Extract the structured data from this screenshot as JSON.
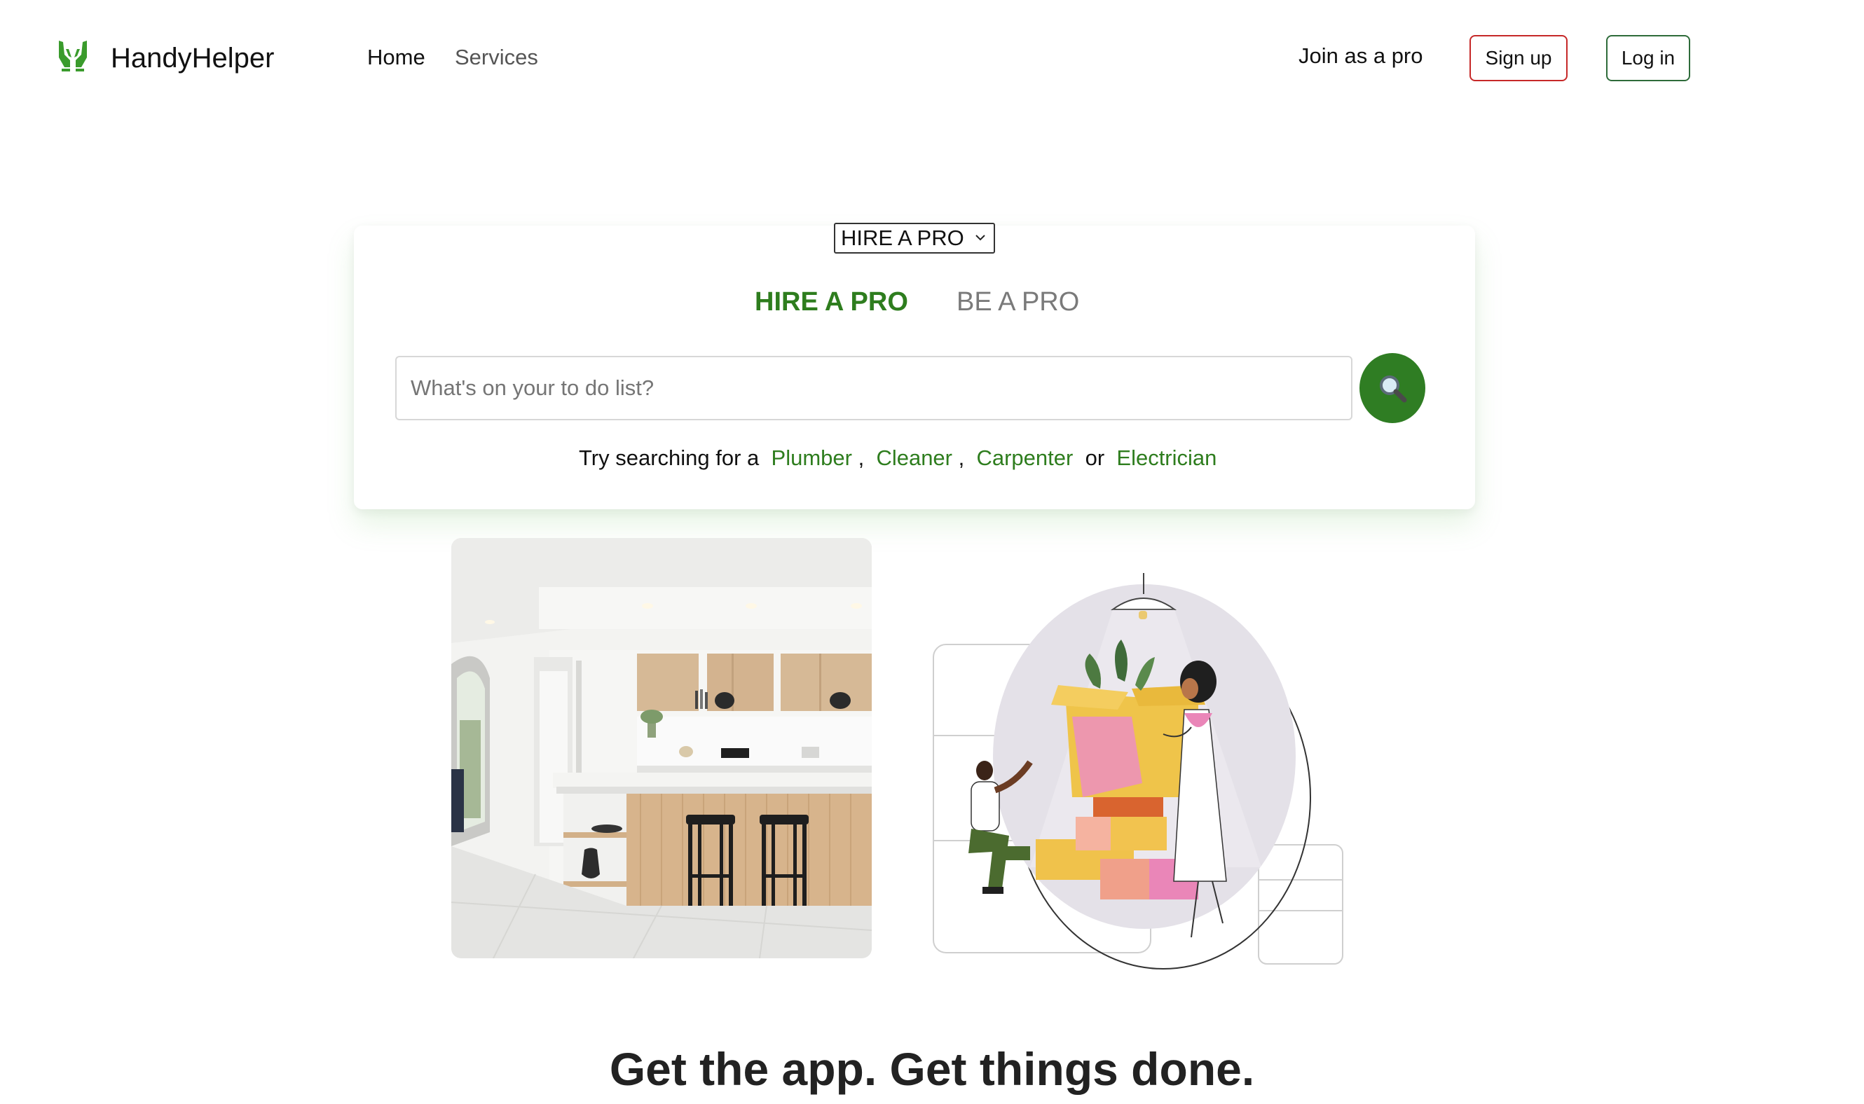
{
  "header": {
    "brand": "HandyHelper",
    "nav": [
      {
        "label": "Home"
      },
      {
        "label": "Services"
      }
    ],
    "join_label": "Join as a pro",
    "signup_label": "Sign up",
    "login_label": "Log in",
    "logo_icon": "helping-hands-icon",
    "brand_color": "#3a9b2c"
  },
  "search_card": {
    "mode_select": {
      "selected": "HIRE A PRO"
    },
    "tabs": [
      {
        "label": "HIRE A PRO",
        "active": true
      },
      {
        "label": "BE A PRO",
        "active": false
      }
    ],
    "search": {
      "placeholder": "What's on your to do list?",
      "value": ""
    },
    "search_icon": "magnifier-icon",
    "suggest": {
      "prefix": "Try searching for a",
      "items": [
        "Plumber",
        "Cleaner",
        "Carpenter",
        "Electrician"
      ],
      "sep": ",",
      "or": "or"
    },
    "accent_color": "#2e7d1e"
  },
  "media": {
    "kitchen_image": "kitchen-photo",
    "illustration": "moving-boxes-illustration"
  },
  "headline": "Get the app. Get things done."
}
